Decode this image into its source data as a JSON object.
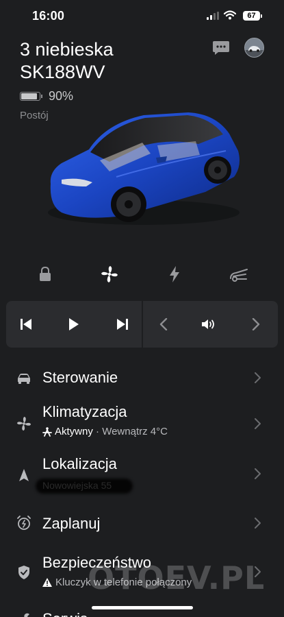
{
  "status_bar": {
    "time": "16:00",
    "battery": "67"
  },
  "header": {
    "car_name": "3 niebieska",
    "plate": "SK188WV",
    "battery_percent": "90%",
    "battery_level": 0.9,
    "status": "Postój"
  },
  "quick_controls": [
    "lock-icon",
    "fan-icon",
    "bolt-icon",
    "trunk-icon"
  ],
  "media": [
    "previous-track-icon",
    "play-icon",
    "next-track-icon",
    "back-chevron-icon",
    "volume-icon",
    "forward-chevron-icon"
  ],
  "menu": [
    {
      "title": "Sterowanie",
      "icon": "car-icon"
    },
    {
      "title": "Klimatyzacja",
      "icon": "fan-icon",
      "sub_strong": "Aktywny",
      "sub_sep": " · ",
      "sub_rest": "Wewnątrz 4°C"
    },
    {
      "title": "Lokalizacja",
      "icon": "navigation-arrow-icon",
      "sub": "Nowowiejska 55"
    },
    {
      "title": "Zaplanuj",
      "icon": "alarm-clock-icon"
    },
    {
      "title": "Bezpieczeństwo",
      "icon": "shield-icon",
      "sub": "Kluczyk w telefonie połączony"
    },
    {
      "title": "Serwis",
      "icon": "wrench-icon"
    }
  ],
  "watermark": "OTOEV.PL",
  "colors": {
    "background": "#1d1e20",
    "panel": "#2b2c2f",
    "car_blue": "#1f4fd0"
  }
}
